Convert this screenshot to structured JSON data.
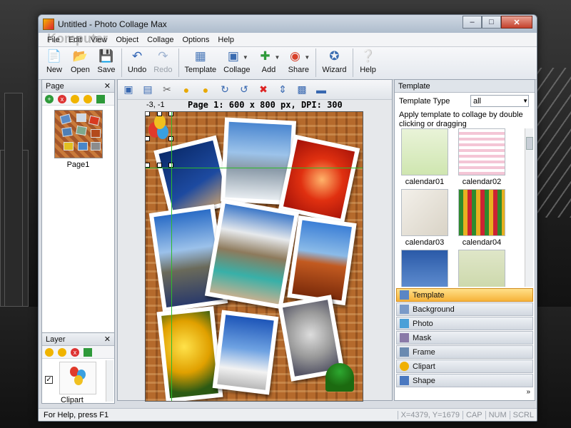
{
  "window": {
    "title": "Untitled - Photo Collage Max"
  },
  "menu": [
    "File",
    "Edit",
    "View",
    "Object",
    "Collage",
    "Options",
    "Help"
  ],
  "toolbar": [
    {
      "label": "New",
      "icon": "new-document-icon"
    },
    {
      "label": "Open",
      "icon": "open-folder-icon"
    },
    {
      "label": "Save",
      "icon": "save-icon"
    },
    {
      "label": "Undo",
      "icon": "undo-icon"
    },
    {
      "label": "Redo",
      "icon": "redo-icon"
    },
    {
      "label": "Template",
      "icon": "template-icon"
    },
    {
      "label": "Collage",
      "icon": "collage-icon"
    },
    {
      "label": "Add",
      "icon": "add-icon"
    },
    {
      "label": "Share",
      "icon": "share-icon"
    },
    {
      "label": "Wizard",
      "icon": "wizard-icon"
    },
    {
      "label": "Help",
      "icon": "help-icon"
    }
  ],
  "left": {
    "page_title": "Page",
    "page_thumb_label": "Page1",
    "layer_title": "Layer",
    "layer_item_label": "Clipart"
  },
  "canvas": {
    "coord": "-3, -1",
    "page_label": "Page 1: 600 x 800 px, DPI: 300"
  },
  "right": {
    "panel_title": "Template",
    "template_type_label": "Template Type",
    "template_type_value": "all",
    "hint": "Apply template to collage by double clicking or dragging",
    "templates": [
      "calendar01",
      "calendar02",
      "calendar03",
      "calendar04"
    ],
    "categories": [
      "Template",
      "Background",
      "Photo",
      "Mask",
      "Frame",
      "Clipart",
      "Shape"
    ]
  },
  "status": {
    "help": "For Help, press F1",
    "xy": "X=4379, Y=1679",
    "cap": "CAP",
    "num": "NUM",
    "scrl": "SCRL"
  },
  "watermark": "Komputer"
}
